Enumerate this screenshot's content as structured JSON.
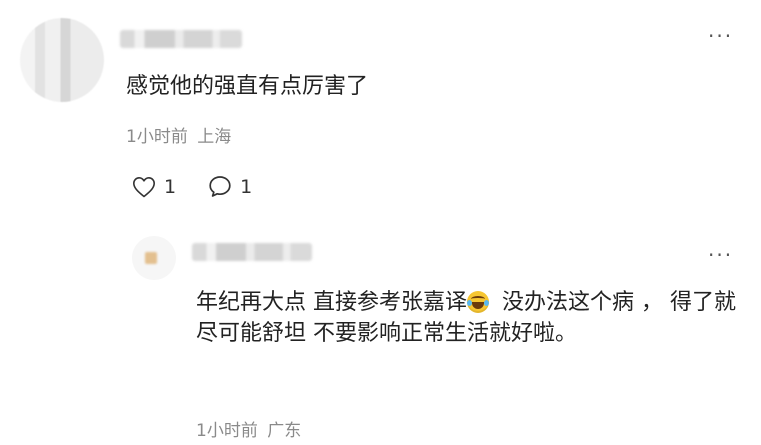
{
  "comment": {
    "text": "感觉他的强直有点厉害了",
    "time": "1小时前",
    "location": "上海",
    "like_count": "1",
    "reply_count": "1",
    "more_label": "···"
  },
  "reply": {
    "text_before": "年纪再大点 直接参考张嘉译",
    "text_after": " 没办法这个病 ， 得了就尽可能舒坦 不要影响正常生活就好啦。",
    "emoji": "grinning-with-sweat-emoji",
    "time": "1小时前",
    "location": "广东",
    "more_label": "···"
  }
}
